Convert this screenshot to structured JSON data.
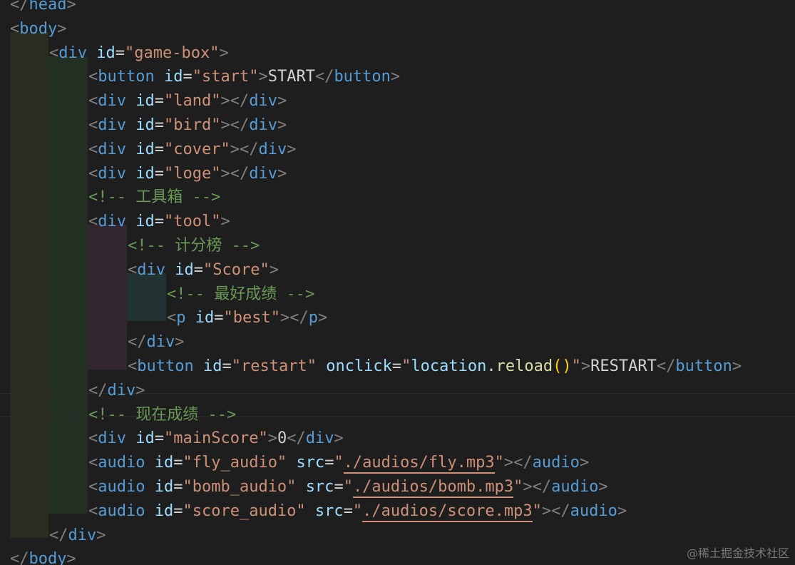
{
  "editor": {
    "theme_colors": {
      "background": "#1e1e1e",
      "tag": "#569cd6",
      "attribute": "#9cdcfe",
      "string": "#ce9178",
      "comment": "#6a9955",
      "punctuation": "#808080",
      "text": "#d4d4d4",
      "function": "#dcdcaa",
      "bracket": "#ffd700"
    },
    "lines": [
      {
        "indent": 0,
        "tokens": [
          {
            "c": "p",
            "t": "</"
          },
          {
            "c": "t",
            "t": "head"
          },
          {
            "c": "p",
            "t": ">"
          }
        ]
      },
      {
        "indent": 0,
        "tokens": [
          {
            "c": "p",
            "t": "<"
          },
          {
            "c": "t",
            "t": "body"
          },
          {
            "c": "p",
            "t": ">"
          }
        ]
      },
      {
        "indent": 1,
        "tokens": [
          {
            "c": "p",
            "t": "<"
          },
          {
            "c": "t",
            "t": "div"
          },
          {
            "c": "x",
            "t": " "
          },
          {
            "c": "a",
            "t": "id"
          },
          {
            "c": "e",
            "t": "="
          },
          {
            "c": "s",
            "t": "\"game-box\""
          },
          {
            "c": "p",
            "t": ">"
          }
        ]
      },
      {
        "indent": 2,
        "tokens": [
          {
            "c": "p",
            "t": "<"
          },
          {
            "c": "t",
            "t": "button"
          },
          {
            "c": "x",
            "t": " "
          },
          {
            "c": "a",
            "t": "id"
          },
          {
            "c": "e",
            "t": "="
          },
          {
            "c": "s",
            "t": "\"start\""
          },
          {
            "c": "p",
            "t": ">"
          },
          {
            "c": "x",
            "t": "START"
          },
          {
            "c": "p",
            "t": "</"
          },
          {
            "c": "t",
            "t": "button"
          },
          {
            "c": "p",
            "t": ">"
          }
        ]
      },
      {
        "indent": 2,
        "tokens": [
          {
            "c": "p",
            "t": "<"
          },
          {
            "c": "t",
            "t": "div"
          },
          {
            "c": "x",
            "t": " "
          },
          {
            "c": "a",
            "t": "id"
          },
          {
            "c": "e",
            "t": "="
          },
          {
            "c": "s",
            "t": "\"land\""
          },
          {
            "c": "p",
            "t": "></"
          },
          {
            "c": "t",
            "t": "div"
          },
          {
            "c": "p",
            "t": ">"
          }
        ]
      },
      {
        "indent": 2,
        "tokens": [
          {
            "c": "p",
            "t": "<"
          },
          {
            "c": "t",
            "t": "div"
          },
          {
            "c": "x",
            "t": " "
          },
          {
            "c": "a",
            "t": "id"
          },
          {
            "c": "e",
            "t": "="
          },
          {
            "c": "s",
            "t": "\"bird\""
          },
          {
            "c": "p",
            "t": "></"
          },
          {
            "c": "t",
            "t": "div"
          },
          {
            "c": "p",
            "t": ">"
          }
        ]
      },
      {
        "indent": 2,
        "tokens": [
          {
            "c": "p",
            "t": "<"
          },
          {
            "c": "t",
            "t": "div"
          },
          {
            "c": "x",
            "t": " "
          },
          {
            "c": "a",
            "t": "id"
          },
          {
            "c": "e",
            "t": "="
          },
          {
            "c": "s",
            "t": "\"cover\""
          },
          {
            "c": "p",
            "t": "></"
          },
          {
            "c": "t",
            "t": "div"
          },
          {
            "c": "p",
            "t": ">"
          }
        ]
      },
      {
        "indent": 2,
        "tokens": [
          {
            "c": "p",
            "t": "<"
          },
          {
            "c": "t",
            "t": "div"
          },
          {
            "c": "x",
            "t": " "
          },
          {
            "c": "a",
            "t": "id"
          },
          {
            "c": "e",
            "t": "="
          },
          {
            "c": "s",
            "t": "\"loge\""
          },
          {
            "c": "p",
            "t": "></"
          },
          {
            "c": "t",
            "t": "div"
          },
          {
            "c": "p",
            "t": ">"
          }
        ]
      },
      {
        "indent": 2,
        "tokens": [
          {
            "c": "c",
            "t": "<!-- 工具箱 -->"
          }
        ]
      },
      {
        "indent": 2,
        "tokens": [
          {
            "c": "p",
            "t": "<"
          },
          {
            "c": "t",
            "t": "div"
          },
          {
            "c": "x",
            "t": " "
          },
          {
            "c": "a",
            "t": "id"
          },
          {
            "c": "e",
            "t": "="
          },
          {
            "c": "s",
            "t": "\"tool\""
          },
          {
            "c": "p",
            "t": ">"
          }
        ]
      },
      {
        "indent": 3,
        "tokens": [
          {
            "c": "c",
            "t": "<!-- 计分榜 -->"
          }
        ]
      },
      {
        "indent": 3,
        "tokens": [
          {
            "c": "p",
            "t": "<"
          },
          {
            "c": "t",
            "t": "div"
          },
          {
            "c": "x",
            "t": " "
          },
          {
            "c": "a",
            "t": "id"
          },
          {
            "c": "e",
            "t": "="
          },
          {
            "c": "s",
            "t": "\"Score\""
          },
          {
            "c": "p",
            "t": ">"
          }
        ]
      },
      {
        "indent": 4,
        "tokens": [
          {
            "c": "c",
            "t": "<!-- 最好成绩 -->"
          }
        ]
      },
      {
        "indent": 4,
        "tokens": [
          {
            "c": "p",
            "t": "<"
          },
          {
            "c": "t",
            "t": "p"
          },
          {
            "c": "x",
            "t": " "
          },
          {
            "c": "a",
            "t": "id"
          },
          {
            "c": "e",
            "t": "="
          },
          {
            "c": "s",
            "t": "\"best\""
          },
          {
            "c": "p",
            "t": "></"
          },
          {
            "c": "t",
            "t": "p"
          },
          {
            "c": "p",
            "t": ">"
          }
        ]
      },
      {
        "indent": 3,
        "tokens": [
          {
            "c": "p",
            "t": "</"
          },
          {
            "c": "t",
            "t": "div"
          },
          {
            "c": "p",
            "t": ">"
          }
        ]
      },
      {
        "indent": 3,
        "tokens": [
          {
            "c": "p",
            "t": "<"
          },
          {
            "c": "t",
            "t": "button"
          },
          {
            "c": "x",
            "t": " "
          },
          {
            "c": "a",
            "t": "id"
          },
          {
            "c": "e",
            "t": "="
          },
          {
            "c": "s",
            "t": "\"restart\""
          },
          {
            "c": "x",
            "t": " "
          },
          {
            "c": "a",
            "t": "onclick"
          },
          {
            "c": "e",
            "t": "="
          },
          {
            "c": "s",
            "t": "\""
          },
          {
            "c": "a",
            "t": "location"
          },
          {
            "c": "e",
            "t": "."
          },
          {
            "c": "f",
            "t": "reload"
          },
          {
            "c": "b",
            "t": "()"
          },
          {
            "c": "s",
            "t": "\""
          },
          {
            "c": "p",
            "t": ">"
          },
          {
            "c": "x",
            "t": "RESTART"
          },
          {
            "c": "p",
            "t": "</"
          },
          {
            "c": "t",
            "t": "button"
          },
          {
            "c": "p",
            "t": ">"
          }
        ]
      },
      {
        "indent": 2,
        "tokens": [
          {
            "c": "p",
            "t": "</"
          },
          {
            "c": "t",
            "t": "div"
          },
          {
            "c": "p",
            "t": ">"
          }
        ]
      },
      {
        "indent": 2,
        "current": true,
        "tokens": [
          {
            "c": "c",
            "t": "<!-- 现在成绩 -->"
          }
        ]
      },
      {
        "indent": 2,
        "tokens": [
          {
            "c": "p",
            "t": "<"
          },
          {
            "c": "t",
            "t": "div"
          },
          {
            "c": "x",
            "t": " "
          },
          {
            "c": "a",
            "t": "id"
          },
          {
            "c": "e",
            "t": "="
          },
          {
            "c": "s",
            "t": "\"mainScore\""
          },
          {
            "c": "p",
            "t": ">"
          },
          {
            "c": "x",
            "t": "0"
          },
          {
            "c": "p",
            "t": "</"
          },
          {
            "c": "t",
            "t": "div"
          },
          {
            "c": "p",
            "t": ">"
          }
        ]
      },
      {
        "indent": 2,
        "tokens": [
          {
            "c": "p",
            "t": "<"
          },
          {
            "c": "t",
            "t": "audio"
          },
          {
            "c": "x",
            "t": " "
          },
          {
            "c": "a",
            "t": "id"
          },
          {
            "c": "e",
            "t": "="
          },
          {
            "c": "s",
            "t": "\"fly_audio\""
          },
          {
            "c": "x",
            "t": " "
          },
          {
            "c": "a",
            "t": "src"
          },
          {
            "c": "e",
            "t": "="
          },
          {
            "c": "s",
            "t": "\""
          },
          {
            "c": "u",
            "t": "./audios/fly.mp3"
          },
          {
            "c": "s",
            "t": "\""
          },
          {
            "c": "p",
            "t": "></"
          },
          {
            "c": "t",
            "t": "audio"
          },
          {
            "c": "p",
            "t": ">"
          }
        ]
      },
      {
        "indent": 2,
        "tokens": [
          {
            "c": "p",
            "t": "<"
          },
          {
            "c": "t",
            "t": "audio"
          },
          {
            "c": "x",
            "t": " "
          },
          {
            "c": "a",
            "t": "id"
          },
          {
            "c": "e",
            "t": "="
          },
          {
            "c": "s",
            "t": "\"bomb_audio\""
          },
          {
            "c": "x",
            "t": " "
          },
          {
            "c": "a",
            "t": "src"
          },
          {
            "c": "e",
            "t": "="
          },
          {
            "c": "s",
            "t": "\""
          },
          {
            "c": "u",
            "t": "./audios/bomb.mp3"
          },
          {
            "c": "s",
            "t": "\""
          },
          {
            "c": "p",
            "t": "></"
          },
          {
            "c": "t",
            "t": "audio"
          },
          {
            "c": "p",
            "t": ">"
          }
        ]
      },
      {
        "indent": 2,
        "tokens": [
          {
            "c": "p",
            "t": "<"
          },
          {
            "c": "t",
            "t": "audio"
          },
          {
            "c": "x",
            "t": " "
          },
          {
            "c": "a",
            "t": "id"
          },
          {
            "c": "e",
            "t": "="
          },
          {
            "c": "s",
            "t": "\"score_audio\""
          },
          {
            "c": "x",
            "t": " "
          },
          {
            "c": "a",
            "t": "src"
          },
          {
            "c": "e",
            "t": "="
          },
          {
            "c": "s",
            "t": "\""
          },
          {
            "c": "u",
            "t": "./audios/score.mp3"
          },
          {
            "c": "s",
            "t": "\""
          },
          {
            "c": "p",
            "t": "></"
          },
          {
            "c": "t",
            "t": "audio"
          },
          {
            "c": "p",
            "t": ">"
          }
        ]
      },
      {
        "indent": 1,
        "tokens": [
          {
            "c": "p",
            "t": "</"
          },
          {
            "c": "t",
            "t": "div"
          },
          {
            "c": "p",
            "t": ">"
          }
        ]
      },
      {
        "indent": 0,
        "tokens": [
          {
            "c": "p",
            "t": "</"
          },
          {
            "c": "t",
            "t": "body"
          },
          {
            "c": "p",
            "t": ">"
          }
        ]
      }
    ]
  },
  "watermark": "@稀土掘金技术社区"
}
